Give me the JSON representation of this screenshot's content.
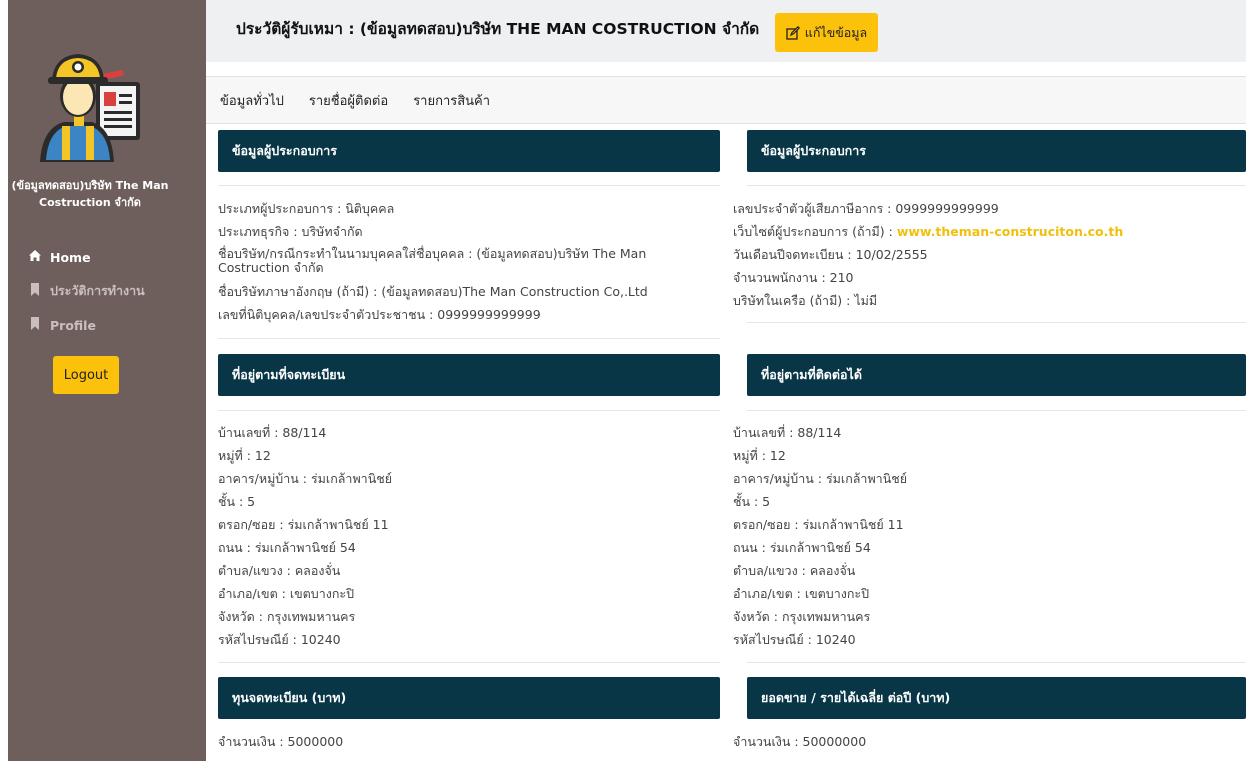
{
  "sidebar": {
    "company_name": "(ข้อมูลทดสอบ)บริษัท The Man Costruction จำกัด",
    "nav": [
      {
        "icon": "home-icon",
        "label": "Home"
      },
      {
        "icon": "bookmark-icon",
        "label": "ประวัติการทำงาน"
      },
      {
        "icon": "bookmark-icon",
        "label": "Profile"
      }
    ],
    "logout_label": "Logout"
  },
  "header": {
    "title": "ประวัติผู้รับเหมา : (ข้อมูลทดสอบ)บริษัท THE MAN COSTRUCTION จำกัด",
    "edit_label": "แก้ไขข้อมูล"
  },
  "tabs": [
    "ข้อมูลทั่วไป",
    "รายชื่อผู้ติดต่อ",
    "รายการสินค้า"
  ],
  "operator_left": {
    "title": "ข้อมูลผู้ประกอบการ",
    "rows": [
      "ประเภทผู้ประกอบการ : นิติบุคคล",
      "ประเภทธุรกิจ : บริษัทจำกัด",
      "ชื่อบริษัท/กรณีกระทำในนามบุคคลใส่ชื่อบุคคล : (ข้อมูลทดสอบ)บริษัท The Man Costruction จำกัด",
      "ชื่อบริษัทภาษาอังกฤษ (ถ้ามี) : (ข้อมูลทดสอบ)The Man Construction Co,.Ltd",
      "เลขที่นิติบุคคล/เลขประจำตัวประชาชน : 0999999999999"
    ]
  },
  "operator_right": {
    "title": "ข้อมูลผู้ประกอบการ",
    "tax_id": "เลขประจำตัวผู้เสียภาษีอากร : 0999999999999",
    "website_label": "เว็บไซต์ผู้ประกอบการ (ถ้ามี) : ",
    "website_url": "www.theman-construciton.co.th",
    "registered_date": "วันเดือนปีจดทะเบียน : 10/02/2555",
    "employees": "จำนวนพนักงาน : 210",
    "affiliates": "บริษัทในเครือ (ถ้ามี) : ไม่มี"
  },
  "address_registered": {
    "title": "ที่อยู่ตามที่จดทะเบียน",
    "rows": [
      "บ้านเลขที่ : 88/114",
      "หมู่ที่ : 12",
      "อาคาร/หมู่บ้าน : ร่มเกล้าพานิชย์",
      "ชั้น : 5",
      "ตรอก/ซอย : ร่มเกล้าพานิชย์ 11",
      "ถนน : ร่มเกล้าพานิชย์ 54",
      "ตำบล/แขวง : คลองจั่น",
      "อำเภอ/เขต : เขตบางกะปิ",
      "จังหวัด : กรุงเทพมหานคร",
      "รหัสไปรษณีย์ : 10240"
    ]
  },
  "address_contact": {
    "title": "ที่อยู่ตามที่ติดต่อได้",
    "rows": [
      "บ้านเลขที่ : 88/114",
      "หมู่ที่ : 12",
      "อาคาร/หมู่บ้าน : ร่มเกล้าพานิชย์",
      "ชั้น : 5",
      "ตรอก/ซอย : ร่มเกล้าพานิชย์ 11",
      "ถนน : ร่มเกล้าพานิชย์ 54",
      "ตำบล/แขวง : คลองจั่น",
      "อำเภอ/เขต : เขตบางกะปิ",
      "จังหวัด : กรุงเทพมหานคร",
      "รหัสไปรษณีย์ : 10240"
    ]
  },
  "capital": {
    "title": "ทุนจดทะเบียน (บาท)",
    "amount": "จำนวนเงิน : 5000000"
  },
  "revenue": {
    "title": "ยอดขาย / รายได้เฉลี่ย ต่อปี (บาท)",
    "amount": "จำนวนเงิน : 50000000"
  },
  "colors": {
    "sidebar": "#6f5f5c",
    "card_header": "#083647",
    "accent": "#fcc10a"
  }
}
